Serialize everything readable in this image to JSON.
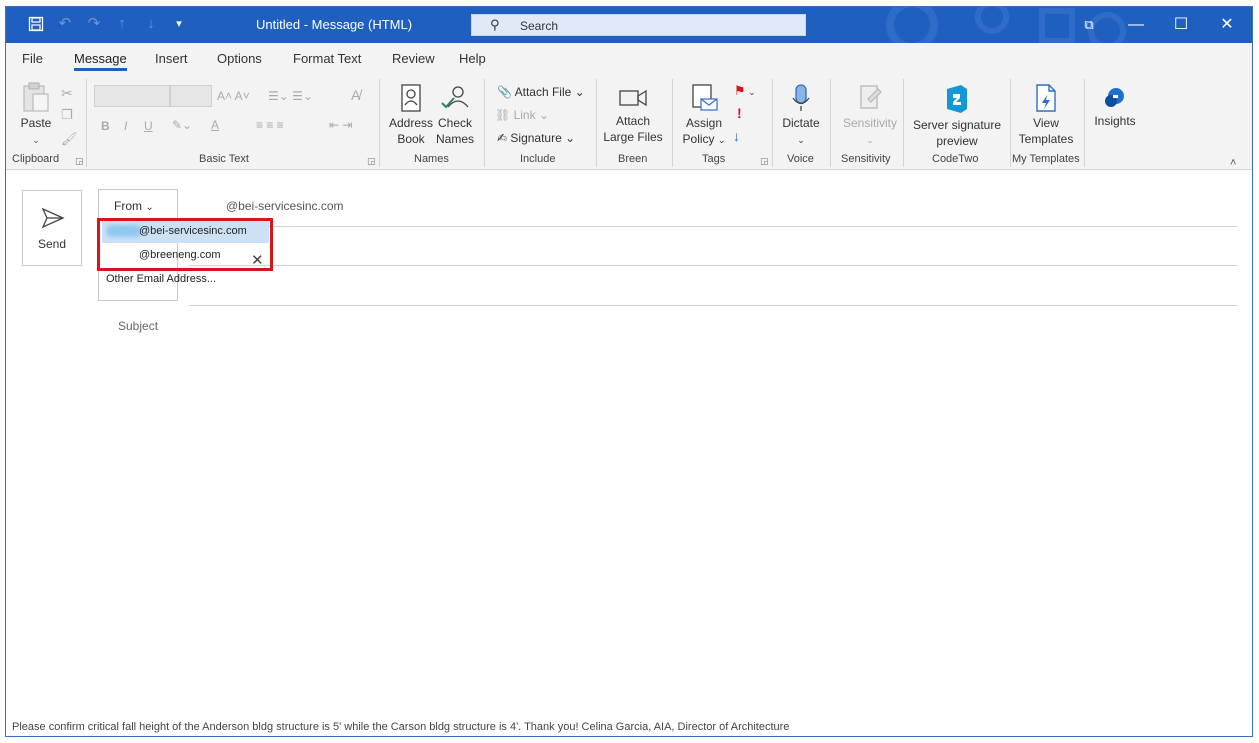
{
  "titlebar": {
    "title": "Untitled  -  Message (HTML)",
    "search_placeholder": "Search"
  },
  "tabs": [
    "File",
    "Message",
    "Insert",
    "Options",
    "Format Text",
    "Review",
    "Help"
  ],
  "ribbon": {
    "clipboard": {
      "paste": "Paste",
      "label": "Clipboard"
    },
    "basic_text": {
      "label": "Basic Text",
      "bold": "B",
      "italic": "I",
      "underline": "U",
      "highlight": "A"
    },
    "names": {
      "address_book": [
        "Address",
        "Book"
      ],
      "check_names": [
        "Check",
        "Names"
      ],
      "label": "Names"
    },
    "include": {
      "attach_file": "Attach File",
      "link": "Link",
      "signature": "Signature",
      "label": "Include"
    },
    "breen": {
      "attach_large": [
        "Attach",
        "Large Files"
      ],
      "label": "Breen"
    },
    "tags": {
      "assign_policy": [
        "Assign",
        "Policy"
      ],
      "label": "Tags"
    },
    "voice": {
      "dictate": "Dictate",
      "label": "Voice"
    },
    "sensitivity": {
      "button": "Sensitivity",
      "label": "Sensitivity"
    },
    "codetwo": {
      "button": [
        "Server signature",
        "preview"
      ],
      "label": "CodeTwo"
    },
    "my_templates": {
      "button": [
        "View",
        "Templates"
      ],
      "label": "My Templates"
    },
    "insights": {
      "button": "Insights"
    }
  },
  "compose": {
    "send": "Send",
    "from_label": "From",
    "from_value": "@bei-servicesinc.com",
    "subject_label": "Subject",
    "dropdown": {
      "items": [
        "@bei-servicesinc.com",
        "@breeneng.com",
        "Other Email Address..."
      ]
    }
  },
  "footer_text": "Please confirm critical fall height of the Anderson bldg structure is 5' while the Carson bldg structure is 4'. Thank you! Celina Garcia, AIA, Director of Architecture"
}
